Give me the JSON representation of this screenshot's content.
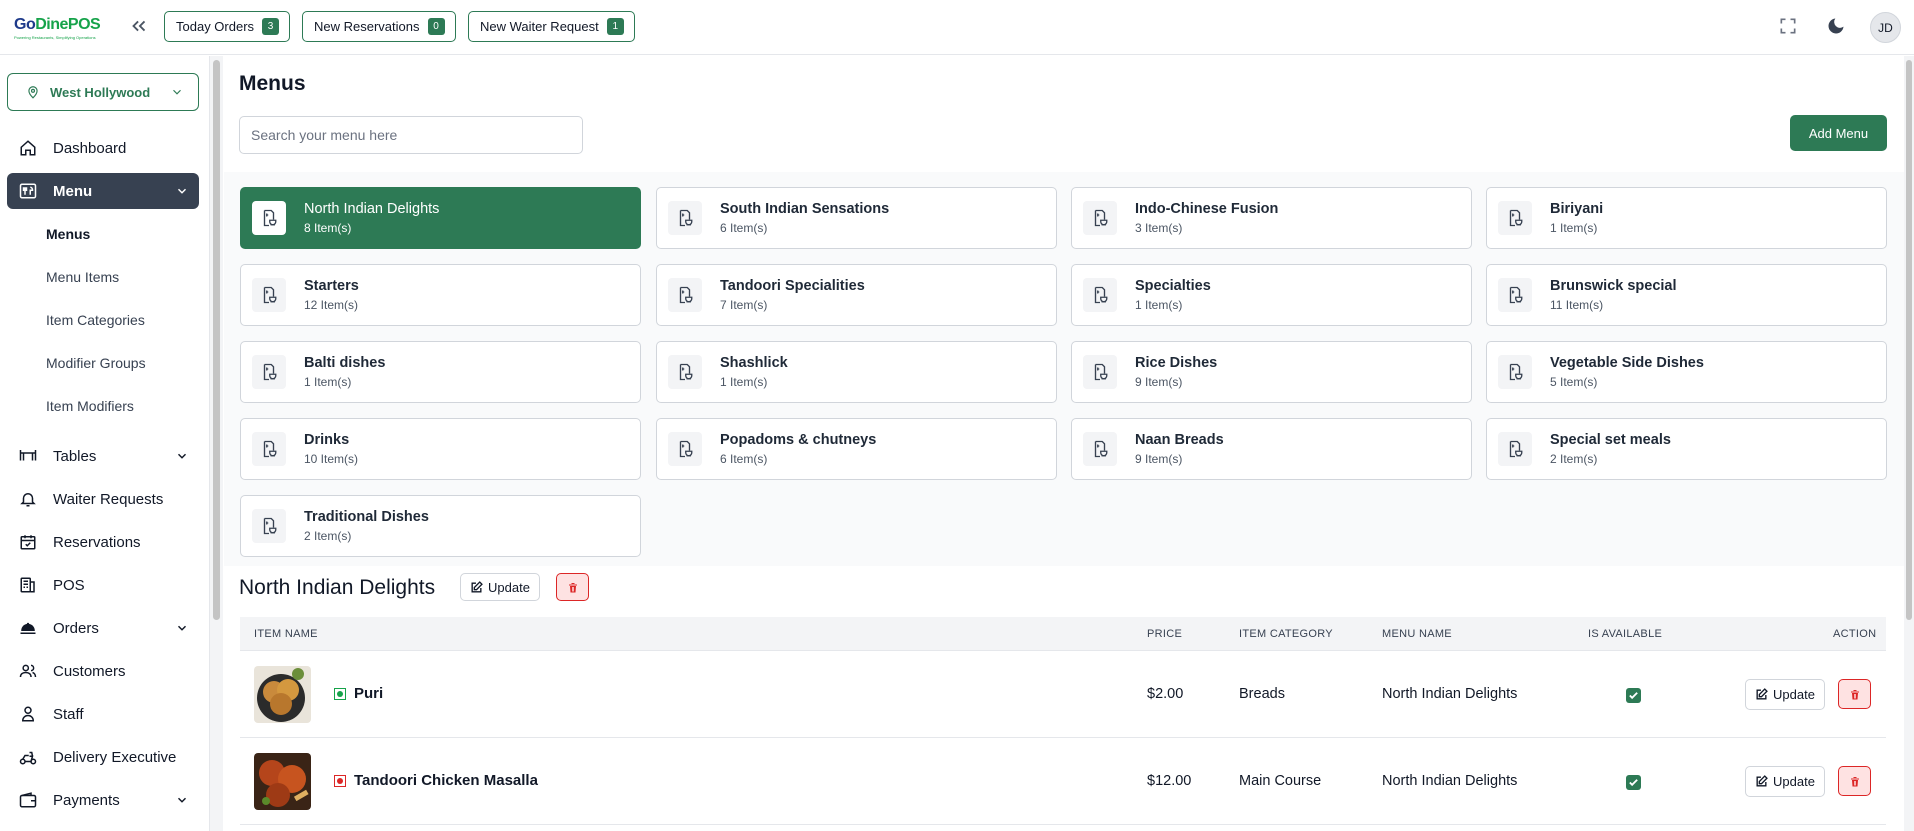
{
  "app": {
    "logo_text_go": "Go",
    "logo_text_rest": "DinePOS",
    "logo_tagline": "Powering Restaurants, Simplifying Operations"
  },
  "topbar": {
    "pills": [
      {
        "label": "Today Orders",
        "count": "3"
      },
      {
        "label": "New Reservations",
        "count": "0"
      },
      {
        "label": "New Waiter Request",
        "count": "1"
      }
    ],
    "avatar_initials": "JD"
  },
  "sidebar": {
    "branch": "West Hollywood",
    "items": [
      {
        "label": "Dashboard"
      },
      {
        "label": "Menu"
      },
      {
        "label": "Tables"
      },
      {
        "label": "Waiter Requests"
      },
      {
        "label": "Reservations"
      },
      {
        "label": "POS"
      },
      {
        "label": "Orders"
      },
      {
        "label": "Customers"
      },
      {
        "label": "Staff"
      },
      {
        "label": "Delivery Executive"
      },
      {
        "label": "Payments"
      }
    ],
    "submenu": [
      "Menus",
      "Menu Items",
      "Item Categories",
      "Modifier Groups",
      "Item Modifiers"
    ]
  },
  "main": {
    "title": "Menus",
    "search_placeholder": "Search your menu here",
    "add_menu_label": "Add Menu",
    "menus": [
      {
        "name": "North Indian Delights",
        "count": "8 Item(s)"
      },
      {
        "name": "South Indian Sensations",
        "count": "6 Item(s)"
      },
      {
        "name": "Indo-Chinese Fusion",
        "count": "3 Item(s)"
      },
      {
        "name": "Biriyani",
        "count": "1 Item(s)"
      },
      {
        "name": "Starters",
        "count": "12 Item(s)"
      },
      {
        "name": "Tandoori Specialities",
        "count": "7 Item(s)"
      },
      {
        "name": "Specialties",
        "count": "1 Item(s)"
      },
      {
        "name": "Brunswick special",
        "count": "11 Item(s)"
      },
      {
        "name": "Balti dishes",
        "count": "1 Item(s)"
      },
      {
        "name": "Shashlick",
        "count": "1 Item(s)"
      },
      {
        "name": "Rice Dishes",
        "count": "9 Item(s)"
      },
      {
        "name": "Vegetable Side Dishes",
        "count": "5 Item(s)"
      },
      {
        "name": "Drinks",
        "count": "10 Item(s)"
      },
      {
        "name": "Popadoms & chutneys",
        "count": "6 Item(s)"
      },
      {
        "name": "Naan Breads",
        "count": "9 Item(s)"
      },
      {
        "name": "Special set meals",
        "count": "2 Item(s)"
      },
      {
        "name": "Traditional Dishes",
        "count": "2 Item(s)"
      }
    ],
    "section_title": "North Indian Delights",
    "update_label": "Update",
    "table": {
      "headers": {
        "item_name": "ITEM NAME",
        "price": "PRICE",
        "category": "ITEM CATEGORY",
        "menu_name": "MENU NAME",
        "available": "IS AVAILABLE",
        "action": "ACTION"
      },
      "rows": [
        {
          "name": "Puri",
          "type": "veg",
          "price": "$2.00",
          "category": "Breads",
          "menu": "North Indian Delights",
          "available": true,
          "update": "Update"
        },
        {
          "name": "Tandoori Chicken Masalla",
          "type": "nonveg",
          "price": "$12.00",
          "category": "Main Course",
          "menu": "North Indian Delights",
          "available": true,
          "update": "Update"
        }
      ]
    }
  },
  "colors": {
    "brand_green": "#2d7a55",
    "active_nav": "#374151",
    "danger": "#dc2626",
    "veg": "#16a34a",
    "nonveg": "#dc2626"
  }
}
